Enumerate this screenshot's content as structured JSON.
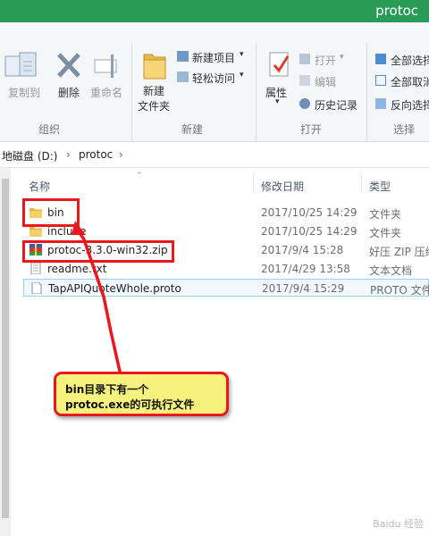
{
  "window": {
    "title": "protoc"
  },
  "ribbon": {
    "copy_path": "复制到",
    "delete": "删除",
    "rename": "重命名",
    "new_folder_line1": "新建",
    "new_folder_line2": "文件夹",
    "new_item": "新建项目",
    "easy_access": "轻松访问",
    "properties": "属性",
    "open": "打开",
    "edit": "编辑",
    "history": "历史记录",
    "select_all": "全部选择",
    "select_none": "全部取消",
    "invert": "反向选择",
    "groups": {
      "organize": "组织",
      "new": "新建",
      "open": "打开",
      "select": "选择"
    }
  },
  "address": {
    "drive": "地磁盘 (D:)",
    "sep": "›",
    "folder": "protoc",
    "sep2": "›"
  },
  "columns": {
    "name": "名称",
    "modified": "修改日期",
    "type": "类型"
  },
  "files": [
    {
      "name": "bin",
      "date": "2017/10/25 14:29",
      "type": "文件夹",
      "icon": "folder-icon"
    },
    {
      "name": "include",
      "date": "2017/10/25 14:29",
      "type": "文件夹",
      "icon": "folder-icon"
    },
    {
      "name": "protoc-3.3.0-win32.zip",
      "date": "2017/9/4 15:28",
      "type": "好压 ZIP 压缩",
      "icon": "zip-icon"
    },
    {
      "name": "readme.txt",
      "date": "2017/4/29 13:58",
      "type": "文本文档",
      "icon": "text-file-icon"
    },
    {
      "name": "TapAPIQuoteWhole.proto",
      "date": "2017/9/4 15:29",
      "type": "PROTO 文件",
      "icon": "blank-file-icon"
    }
  ],
  "annotation": {
    "line1": "bin目录下有一个",
    "line2": "protoc.exe的可执行文件"
  },
  "watermark": "Baidu 经验",
  "colors": {
    "title_bar": "#2a9b56",
    "highlight": "#e8181c",
    "callout_bg": "#f6f27d"
  }
}
